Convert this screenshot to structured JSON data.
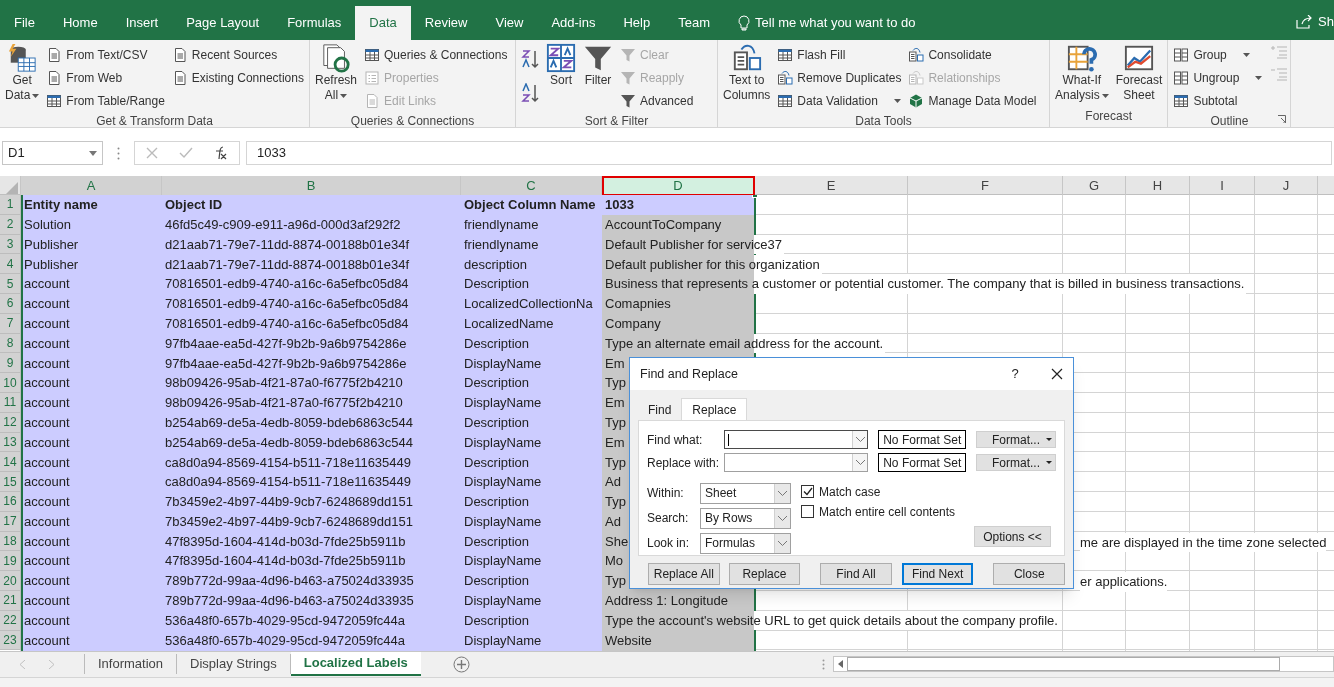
{
  "menu_tabs": [
    {
      "label": "File",
      "selected": false
    },
    {
      "label": "Home",
      "selected": false
    },
    {
      "label": "Insert",
      "selected": false
    },
    {
      "label": "Page Layout",
      "selected": false
    },
    {
      "label": "Formulas",
      "selected": false
    },
    {
      "label": "Data",
      "selected": true
    },
    {
      "label": "Review",
      "selected": false
    },
    {
      "label": "View",
      "selected": false
    },
    {
      "label": "Add-ins",
      "selected": false
    },
    {
      "label": "Help",
      "selected": false
    },
    {
      "label": "Team",
      "selected": false
    }
  ],
  "tell_me": "Tell me what you want to do",
  "share": "Sh",
  "ribbon_groups": [
    {
      "label": "Get & Transform Data",
      "launcher": false,
      "items": [
        {
          "kind": "large",
          "label_lines": [
            "Get",
            "Data"
          ],
          "dropdown": true,
          "disabled": false
        },
        {
          "kind": "column",
          "items": [
            {
              "label": "From Text/CSV",
              "dropdown": false,
              "disabled": false
            },
            {
              "label": "From Web",
              "dropdown": false,
              "disabled": false
            },
            {
              "label": "From Table/Range",
              "dropdown": false,
              "disabled": false
            }
          ]
        },
        {
          "kind": "column",
          "items": [
            {
              "label": "Recent Sources",
              "dropdown": false,
              "disabled": false
            },
            {
              "label": "Existing Connections",
              "dropdown": false,
              "disabled": false
            }
          ]
        }
      ]
    },
    {
      "label": "Queries & Connections",
      "launcher": false,
      "items": [
        {
          "kind": "large",
          "label_lines": [
            "Refresh",
            "All"
          ],
          "dropdown": true,
          "disabled": false
        },
        {
          "kind": "column",
          "items": [
            {
              "label": "Queries & Connections",
              "dropdown": false,
              "disabled": false
            },
            {
              "label": "Properties",
              "dropdown": false,
              "disabled": true
            },
            {
              "label": "Edit Links",
              "dropdown": false,
              "disabled": true
            }
          ]
        }
      ]
    },
    {
      "label": "Sort & Filter",
      "launcher": false,
      "items": [
        {
          "kind": "sort_pair"
        },
        {
          "kind": "large",
          "label_lines": [
            "Sort"
          ],
          "dropdown": false,
          "disabled": false
        },
        {
          "kind": "large",
          "label_lines": [
            "Filter"
          ],
          "dropdown": false,
          "disabled": false
        },
        {
          "kind": "column",
          "items": [
            {
              "label": "Clear",
              "dropdown": false,
              "disabled": true
            },
            {
              "label": "Reapply",
              "dropdown": false,
              "disabled": true
            },
            {
              "label": "Advanced",
              "dropdown": false,
              "disabled": false
            }
          ]
        }
      ]
    },
    {
      "label": "Data Tools",
      "launcher": false,
      "items": [
        {
          "kind": "large",
          "label_lines": [
            "Text to",
            "Columns"
          ],
          "dropdown": false,
          "disabled": false
        },
        {
          "kind": "column",
          "items": [
            {
              "label": "Flash Fill",
              "dropdown": false,
              "disabled": false
            },
            {
              "label": "Remove Duplicates",
              "dropdown": false,
              "disabled": false
            },
            {
              "label": "Data Validation",
              "dropdown": true,
              "disabled": false
            }
          ]
        },
        {
          "kind": "column",
          "items": [
            {
              "label": "Consolidate",
              "dropdown": false,
              "disabled": false
            },
            {
              "label": "Relationships",
              "dropdown": false,
              "disabled": true
            },
            {
              "label": "Manage Data Model",
              "dropdown": false,
              "disabled": false
            }
          ]
        }
      ]
    },
    {
      "label": "Forecast",
      "launcher": false,
      "items": [
        {
          "kind": "large",
          "label_lines": [
            "What-If",
            "Analysis"
          ],
          "dropdown": true,
          "disabled": false
        },
        {
          "kind": "large",
          "label_lines": [
            "Forecast",
            "Sheet"
          ],
          "dropdown": false,
          "disabled": false
        }
      ]
    },
    {
      "label": "Outline",
      "launcher": true,
      "items": [
        {
          "kind": "column",
          "items": [
            {
              "label": "Group",
              "dropdown": true,
              "disabled": false
            },
            {
              "label": "Ungroup",
              "dropdown": true,
              "disabled": false
            },
            {
              "label": "Subtotal",
              "dropdown": false,
              "disabled": false
            }
          ]
        },
        {
          "kind": "detail_pair",
          "disabled": true
        }
      ]
    }
  ],
  "name_box": "D1",
  "formula": "1033",
  "columns": [
    {
      "label": "A",
      "selected": true,
      "highlighted": false
    },
    {
      "label": "B",
      "selected": true,
      "highlighted": false
    },
    {
      "label": "C",
      "selected": true,
      "highlighted": false
    },
    {
      "label": "D",
      "selected": true,
      "highlighted": true
    },
    {
      "label": "E",
      "selected": false,
      "highlighted": false
    },
    {
      "label": "F",
      "selected": false,
      "highlighted": false
    },
    {
      "label": "G",
      "selected": false,
      "highlighted": false
    },
    {
      "label": "H",
      "selected": false,
      "highlighted": false
    },
    {
      "label": "I",
      "selected": false,
      "highlighted": false
    },
    {
      "label": "J",
      "selected": false,
      "highlighted": false
    }
  ],
  "rows": [
    {
      "number": "1",
      "kind": "header",
      "cells": [
        "Entity name",
        "Object ID",
        "Object Column Name",
        "1033"
      ]
    },
    {
      "number": "2",
      "kind": "data",
      "cells": [
        "Solution",
        "46fd5c49-c909-e911-a96d-000d3af292f2",
        "friendlyname",
        "AccountToCompany"
      ]
    },
    {
      "number": "3",
      "kind": "data",
      "cells": [
        "Publisher",
        "d21aab71-79e7-11dd-8874-00188b01e34f",
        "friendlyname",
        "Default Publisher for service37"
      ]
    },
    {
      "number": "4",
      "kind": "data",
      "cells": [
        "Publisher",
        "d21aab71-79e7-11dd-8874-00188b01e34f",
        "description",
        "Default publisher for this organization"
      ]
    },
    {
      "number": "5",
      "kind": "data",
      "cells": [
        "account",
        "70816501-edb9-4740-a16c-6a5efbc05d84",
        "Description",
        "Business that represents a customer or potential customer. The company that is billed in business transactions."
      ]
    },
    {
      "number": "6",
      "kind": "data",
      "cells": [
        "account",
        "70816501-edb9-4740-a16c-6a5efbc05d84",
        "LocalizedCollectionNa",
        "Comapnies"
      ]
    },
    {
      "number": "7",
      "kind": "data",
      "cells": [
        "account",
        "70816501-edb9-4740-a16c-6a5efbc05d84",
        "LocalizedName",
        "Company"
      ]
    },
    {
      "number": "8",
      "kind": "data",
      "cells": [
        "account",
        "97fb4aae-ea5d-427f-9b2b-9a6b9754286e",
        "Description",
        "Type an alternate email address for the account."
      ]
    },
    {
      "number": "9",
      "kind": "data",
      "cells": [
        "account",
        "97fb4aae-ea5d-427f-9b2b-9a6b9754286e",
        "DisplayName",
        "Em"
      ]
    },
    {
      "number": "10",
      "kind": "data",
      "cells": [
        "account",
        "98b09426-95ab-4f21-87a0-f6775f2b4210",
        "Description",
        "Typ"
      ]
    },
    {
      "number": "11",
      "kind": "data",
      "cells": [
        "account",
        "98b09426-95ab-4f21-87a0-f6775f2b4210",
        "DisplayName",
        "Em"
      ]
    },
    {
      "number": "12",
      "kind": "data",
      "cells": [
        "account",
        "b254ab69-de5a-4edb-8059-bdeb6863c544",
        "Description",
        "Typ"
      ]
    },
    {
      "number": "13",
      "kind": "data",
      "cells": [
        "account",
        "b254ab69-de5a-4edb-8059-bdeb6863c544",
        "DisplayName",
        "Em"
      ]
    },
    {
      "number": "14",
      "kind": "data",
      "cells": [
        "account",
        "ca8d0a94-8569-4154-b511-718e11635449",
        "Description",
        "Typ"
      ]
    },
    {
      "number": "15",
      "kind": "data",
      "cells": [
        "account",
        "ca8d0a94-8569-4154-b511-718e11635449",
        "DisplayName",
        "Ad"
      ]
    },
    {
      "number": "16",
      "kind": "data",
      "cells": [
        "account",
        "7b3459e2-4b97-44b9-9cb7-6248689dd151",
        "Description",
        "Typ"
      ]
    },
    {
      "number": "17",
      "kind": "data",
      "cells": [
        "account",
        "7b3459e2-4b97-44b9-9cb7-6248689dd151",
        "DisplayName",
        "Ad"
      ]
    },
    {
      "number": "18",
      "kind": "data",
      "cells": [
        "account",
        "47f8395d-1604-414d-b03d-7fde25b5911b",
        "Description",
        "She"
      ],
      "tail": "me are displayed in the time zone selected"
    },
    {
      "number": "19",
      "kind": "data",
      "cells": [
        "account",
        "47f8395d-1604-414d-b03d-7fde25b5911b",
        "DisplayName",
        "Mo"
      ]
    },
    {
      "number": "20",
      "kind": "data",
      "cells": [
        "account",
        "789b772d-99aa-4d96-b463-a75024d33935",
        "Description",
        "Typ"
      ],
      "tail": "er applications."
    },
    {
      "number": "21",
      "kind": "data",
      "cells": [
        "account",
        "789b772d-99aa-4d96-b463-a75024d33935",
        "DisplayName",
        "Address 1: Longitude"
      ]
    },
    {
      "number": "22",
      "kind": "data",
      "cells": [
        "account",
        "536a48f0-657b-4029-95cd-9472059fc44a",
        "Description",
        "Type the account's website URL to get quick details about the company profile."
      ]
    },
    {
      "number": "23",
      "kind": "data",
      "cells": [
        "account",
        "536a48f0-657b-4029-95cd-9472059fc44a",
        "DisplayName",
        "Website"
      ]
    }
  ],
  "dialog": {
    "title": "Find and Replace",
    "help": "?",
    "tabs": [
      {
        "label": "Find",
        "selected": false
      },
      {
        "label": "Replace",
        "selected": true
      }
    ],
    "fields": [
      {
        "label": "Find what:",
        "focused": true,
        "format": "No Format Set",
        "format_button": "Format..."
      },
      {
        "label": "Replace with:",
        "focused": false,
        "format": "No Format Set",
        "format_button": "Format..."
      }
    ],
    "selects": [
      {
        "label": "Within:",
        "value": "Sheet"
      },
      {
        "label": "Search:",
        "value": "By Rows"
      },
      {
        "label": "Look in:",
        "value": "Formulas"
      }
    ],
    "checkboxes": [
      {
        "label": "Match case",
        "checked": true
      },
      {
        "label": "Match entire cell contents",
        "checked": false
      }
    ],
    "options_button": "Options <<",
    "buttons": [
      {
        "label": "Replace All",
        "default": false
      },
      {
        "label": "Replace",
        "default": false
      },
      {
        "label": "Find All",
        "default": false
      },
      {
        "label": "Find Next",
        "default": true
      },
      {
        "label": "Close",
        "default": false
      }
    ]
  },
  "sheet_tabs": [
    {
      "label": "Information",
      "selected": false
    },
    {
      "label": "Display Strings",
      "selected": false
    },
    {
      "label": "Localized Labels",
      "selected": true
    }
  ]
}
